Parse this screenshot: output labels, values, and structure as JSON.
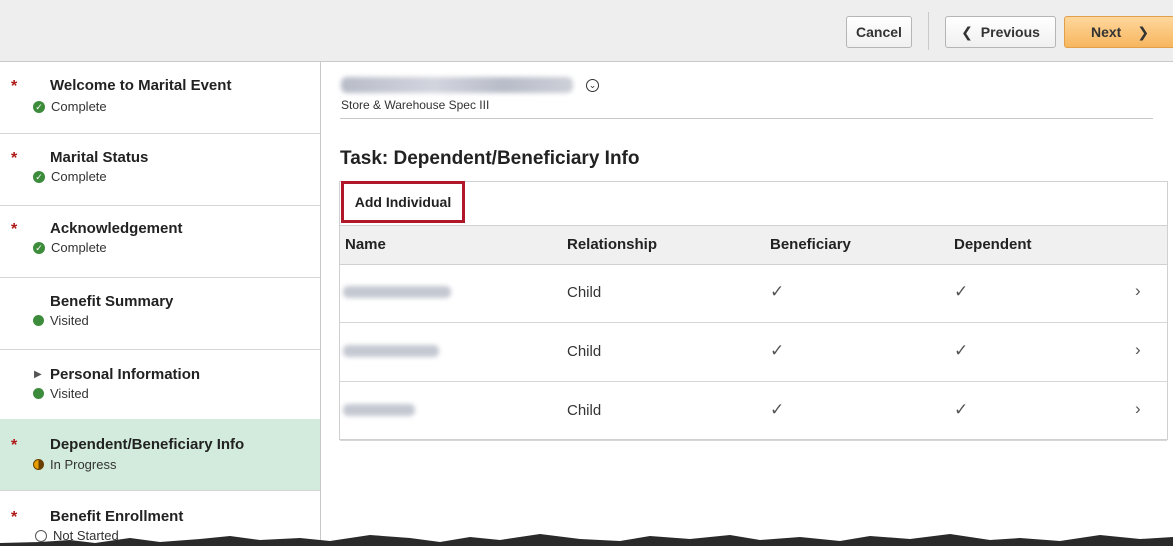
{
  "toolbar": {
    "cancel_label": "Cancel",
    "previous_label": "Previous",
    "next_label": "Next"
  },
  "sidebar": {
    "items": [
      {
        "title": "Welcome to Marital Event",
        "status": "Complete",
        "required": "*",
        "status_icon": "check-circle-icon"
      },
      {
        "title": "Marital Status",
        "status": "Complete",
        "required": "*",
        "status_icon": "check-circle-icon"
      },
      {
        "title": "Acknowledgement",
        "status": "Complete",
        "required": "*",
        "status_icon": "check-circle-icon"
      },
      {
        "title": "Benefit Summary",
        "status": "Visited",
        "required": "",
        "status_icon": "green-dot-icon"
      },
      {
        "title": "Personal Information",
        "status": "Visited",
        "required": "",
        "status_icon": "green-dot-icon"
      },
      {
        "title": "Dependent/Beneficiary Info",
        "status": "In Progress",
        "required": "*",
        "status_icon": "half-circle-icon"
      },
      {
        "title": "Benefit Enrollment",
        "status": "Not Started",
        "required": "*",
        "status_icon": "empty-circle-icon"
      }
    ]
  },
  "main": {
    "job_title": "Store & Warehouse Spec III",
    "task_title": "Task: Dependent/Beneficiary Info",
    "add_label": "Add Individual",
    "columns": [
      "Name",
      "Relationship",
      "Beneficiary",
      "Dependent"
    ],
    "rows": [
      {
        "relationship": "Child",
        "beneficiary": "✓",
        "dependent": "✓"
      },
      {
        "relationship": "Child",
        "beneficiary": "✓",
        "dependent": "✓"
      },
      {
        "relationship": "Child",
        "beneficiary": "✓",
        "dependent": "✓"
      }
    ]
  },
  "colors": {
    "active_step_bg": "#d2ebdc",
    "next_button": "#f7b65f",
    "required_marker": "#b01818",
    "highlight_border": "#b0182a"
  }
}
